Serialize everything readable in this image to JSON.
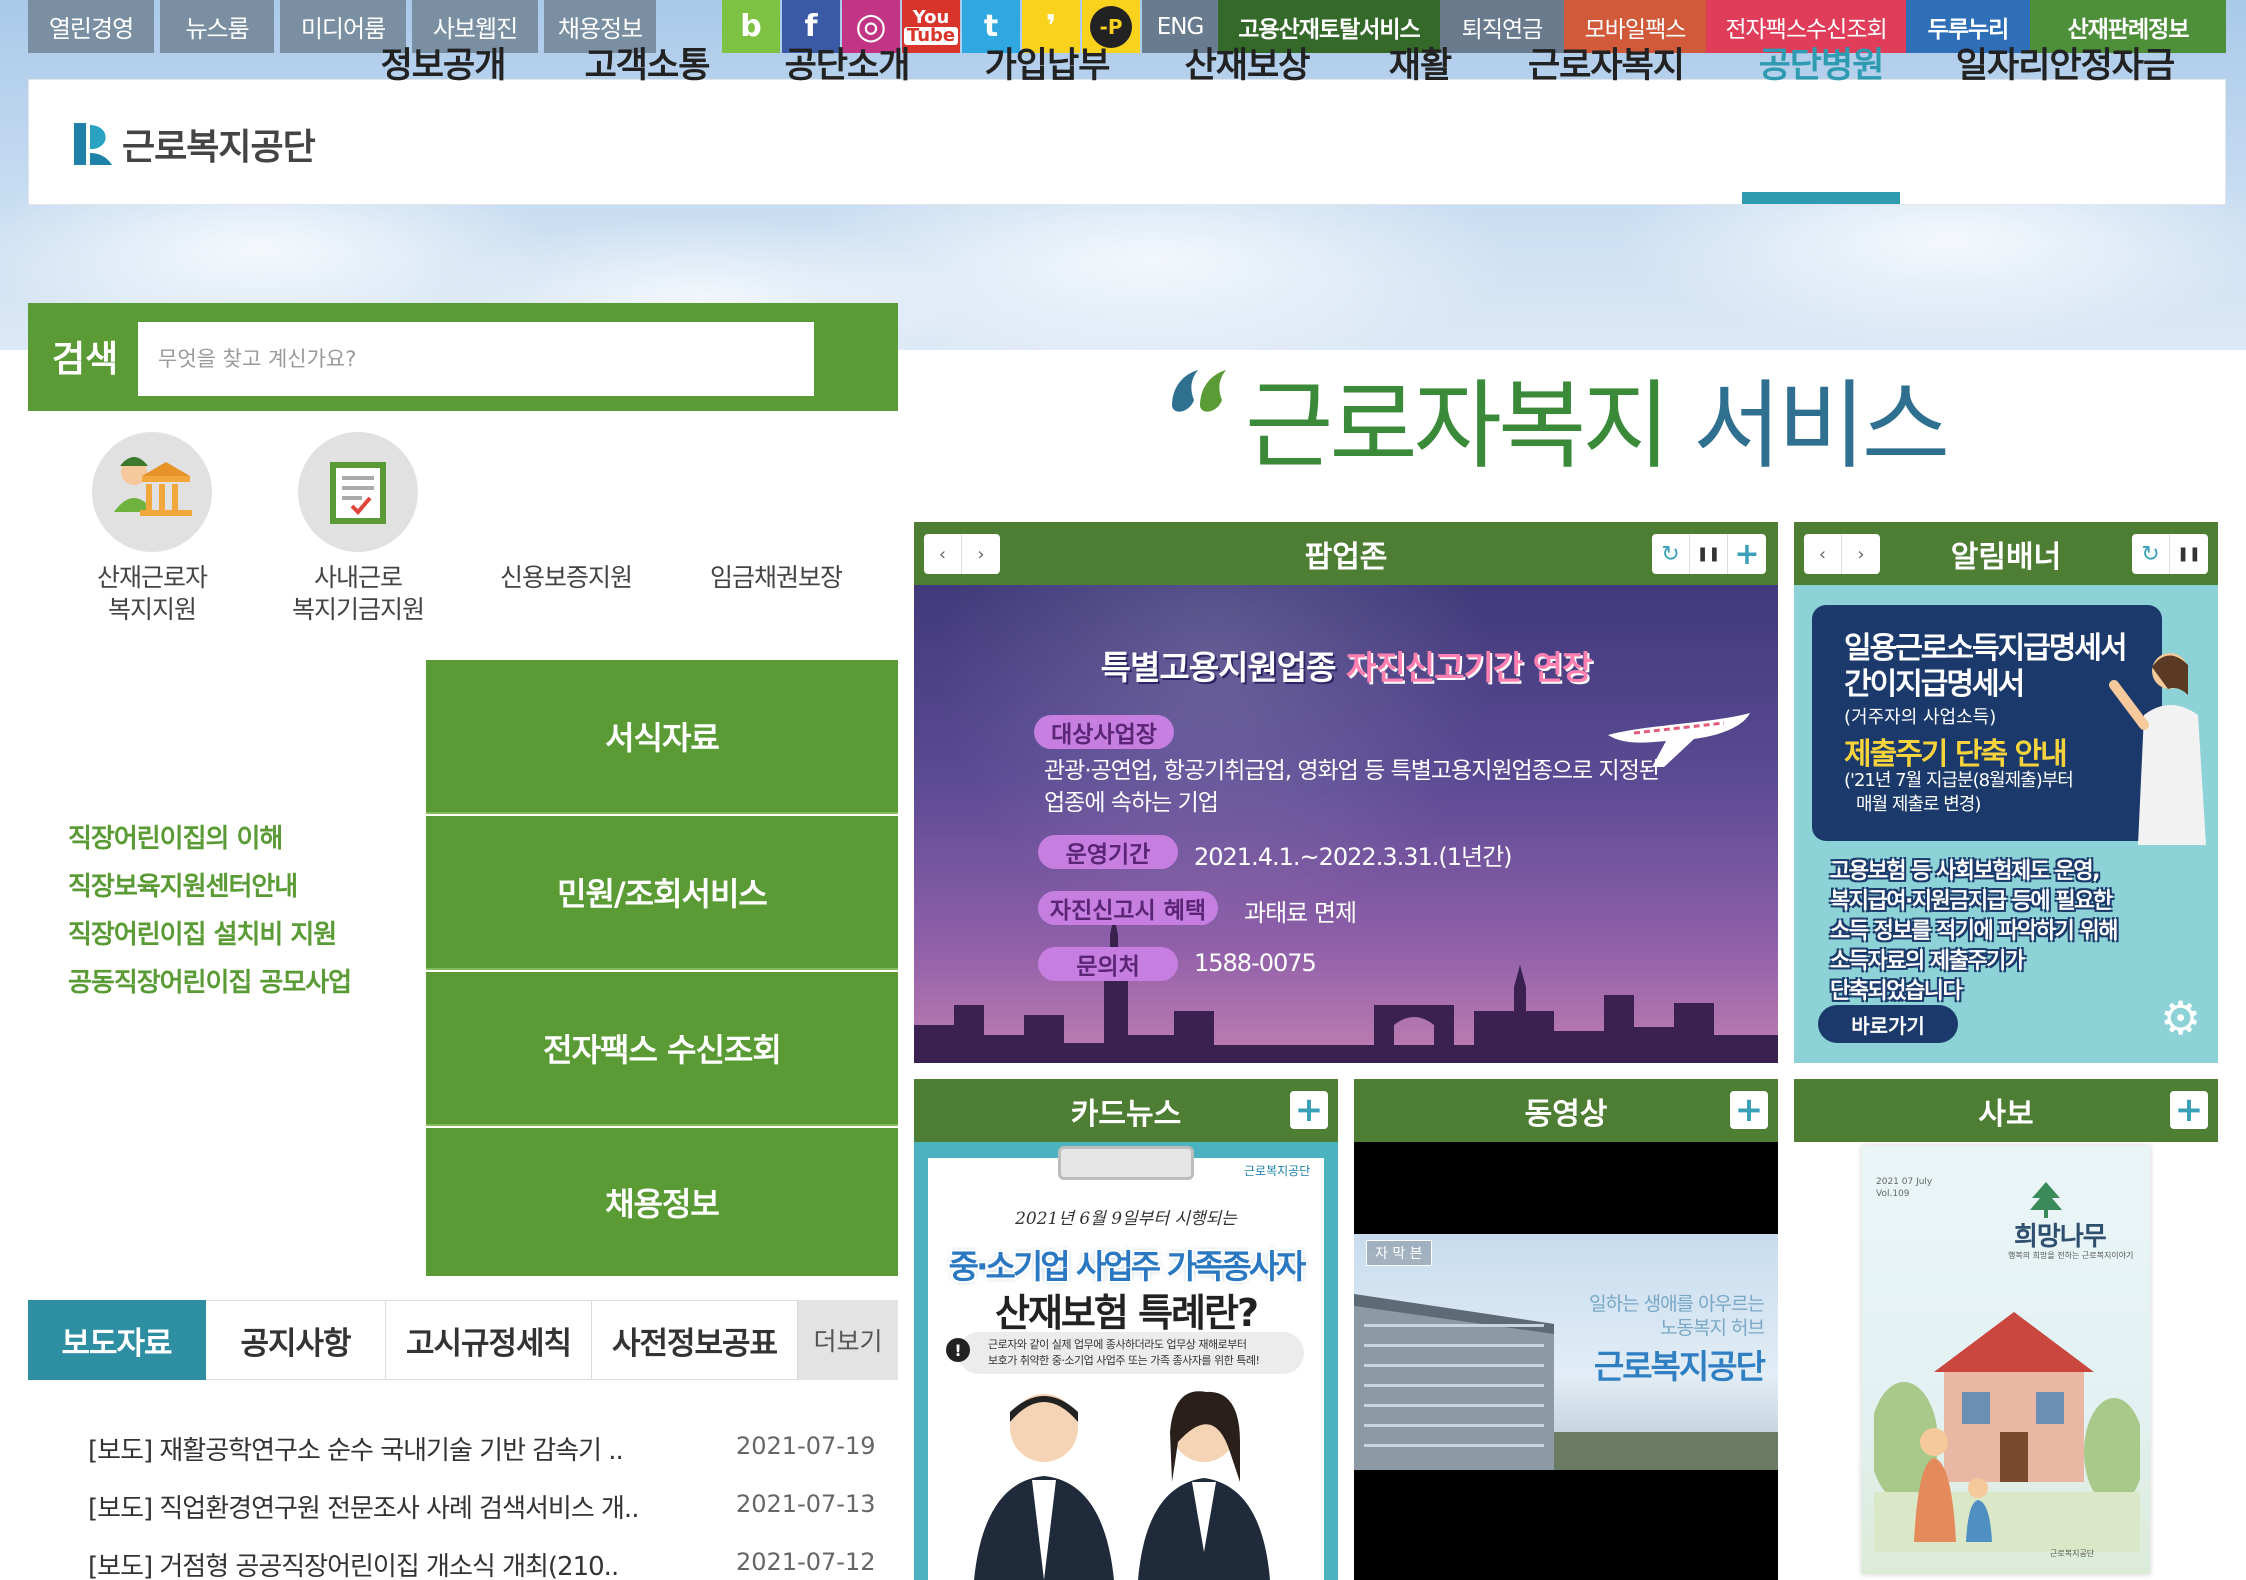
{
  "utility": {
    "links": [
      "열린경영",
      "뉴스룸",
      "미디어룸",
      "사보웹진",
      "채용정보"
    ],
    "sns": {
      "blog": "b",
      "facebook": "f",
      "instagram": "◎",
      "youtube_top": "You",
      "youtube_bottom": "Tube",
      "twitter": "t",
      "kakao": "❜",
      "potal": "-P"
    },
    "eng": "ENG",
    "services": [
      "고용산재토탈서비스",
      "퇴직연금",
      "모바일팩스",
      "전자팩스수신조회",
      "두루누리",
      "산재판례정보"
    ]
  },
  "header": {
    "logo_text": "근로복지공단",
    "nav": [
      "정보공개",
      "고객소통",
      "공단소개",
      "가입납부",
      "산재보상",
      "재활",
      "근로자복지",
      "공단병원",
      "일자리안정자금"
    ]
  },
  "search": {
    "label": "검색",
    "placeholder": "무엇을 찾고 계신가요?"
  },
  "quick": {
    "items": [
      {
        "line1": "산재근로자",
        "line2": "복지지원"
      },
      {
        "line1": "사내근로",
        "line2": "복지기금지원"
      },
      {
        "line1": "신용보증지원",
        "line2": ""
      },
      {
        "line1": "임금채권보장",
        "line2": ""
      }
    ]
  },
  "green_menu": [
    "서식자료",
    "민원/조회서비스",
    "전자팩스 수신조회",
    "채용정보"
  ],
  "green_links": [
    "직장어린이집의 이해",
    "직장보육지원센터안내",
    "직장어린이집 설치비 지원",
    "공동직장어린이집 공모사업"
  ],
  "board": {
    "tabs": [
      "보도자료",
      "공지사항",
      "고시규정세칙",
      "사전정보공표"
    ],
    "more": "더보기",
    "rows": [
      {
        "title": "[보도] 재활공학연구소 순수 국내기술 기반 감속기 ..",
        "date": "2021-07-19"
      },
      {
        "title": "[보도] 직업환경연구원 전문조사 사례 검색서비스 개..",
        "date": "2021-07-13"
      },
      {
        "title": "[보도] 거점형 공공직장어린이집 개소식 개최(210..",
        "date": "2021-07-12"
      }
    ]
  },
  "service": {
    "title_a": "근로자복지",
    "title_b": " 서비스"
  },
  "popup": {
    "title": "팝업존",
    "banner_title_a": "특별고용지원업종 ",
    "banner_title_b": "자진신고기간 연장",
    "tag1": "대상사업장",
    "text1a": "관광·공연업, 항공기취급업, 영화업 등 특별고용지원업종으로 지정된",
    "text1b": "업종에 속하는 기업",
    "tag2": "운영기간",
    "text2": "2021.4.1.~2022.3.31.(1년간)",
    "tag3": "자진신고시 혜택",
    "text3": "과태료 면제",
    "tag4": "문의처",
    "text4": "1588-0075"
  },
  "alarm": {
    "title": "알림배너",
    "l1": "일용근로소득지급명세서",
    "l2": "간이지급명세서",
    "l3": "(거주자의 사업소득)",
    "l4": "제출주기 단축 안내",
    "l5": "('21년 7월 지급분(8월제출)부터",
    "l6": "매월 제출로 변경)",
    "b1": "고용보험 등 사회보험제도 운영,",
    "b2": "복지급여·지원금지급 등에 필요한",
    "b3": "소득 정보를 적기에 파악하기 위해",
    "b4": "소득자료의 제출주기가",
    "b5": "단축되었습니다",
    "btn": "바로가기"
  },
  "card": {
    "title": "카드뉴스",
    "logo": "근로복지공단",
    "script": "2021년 6월 9일부터 시행되는",
    "h1": "중·소기업 사업주 가족종사자",
    "h2": "산재보험 특례란?",
    "note1": "근로자와 같이 실제 업무에 종사하더라도 업무상 재해로부터",
    "note2": "보호가 취약한 중·소기업 사업주 또는 가족 종사자를 위한 특례!"
  },
  "video": {
    "title": "동영상",
    "caption": "자 막 본",
    "line1": "일하는 생애를 아우르는",
    "line2": "노동복지 허브",
    "brand": "근로복지공단"
  },
  "magazine": {
    "title": "사보",
    "date": "2021 07 July",
    "vol": "Vol.109",
    "name": "희망나무",
    "sub": "행복의 희망을 전하는 근로복지이야기",
    "foot": "근로복지공단"
  },
  "colors": {
    "green": "#5a9b35",
    "panel_green": "#4e7d34",
    "teal": "#2e9bb0",
    "utility_gray": "#7b8fa3"
  }
}
